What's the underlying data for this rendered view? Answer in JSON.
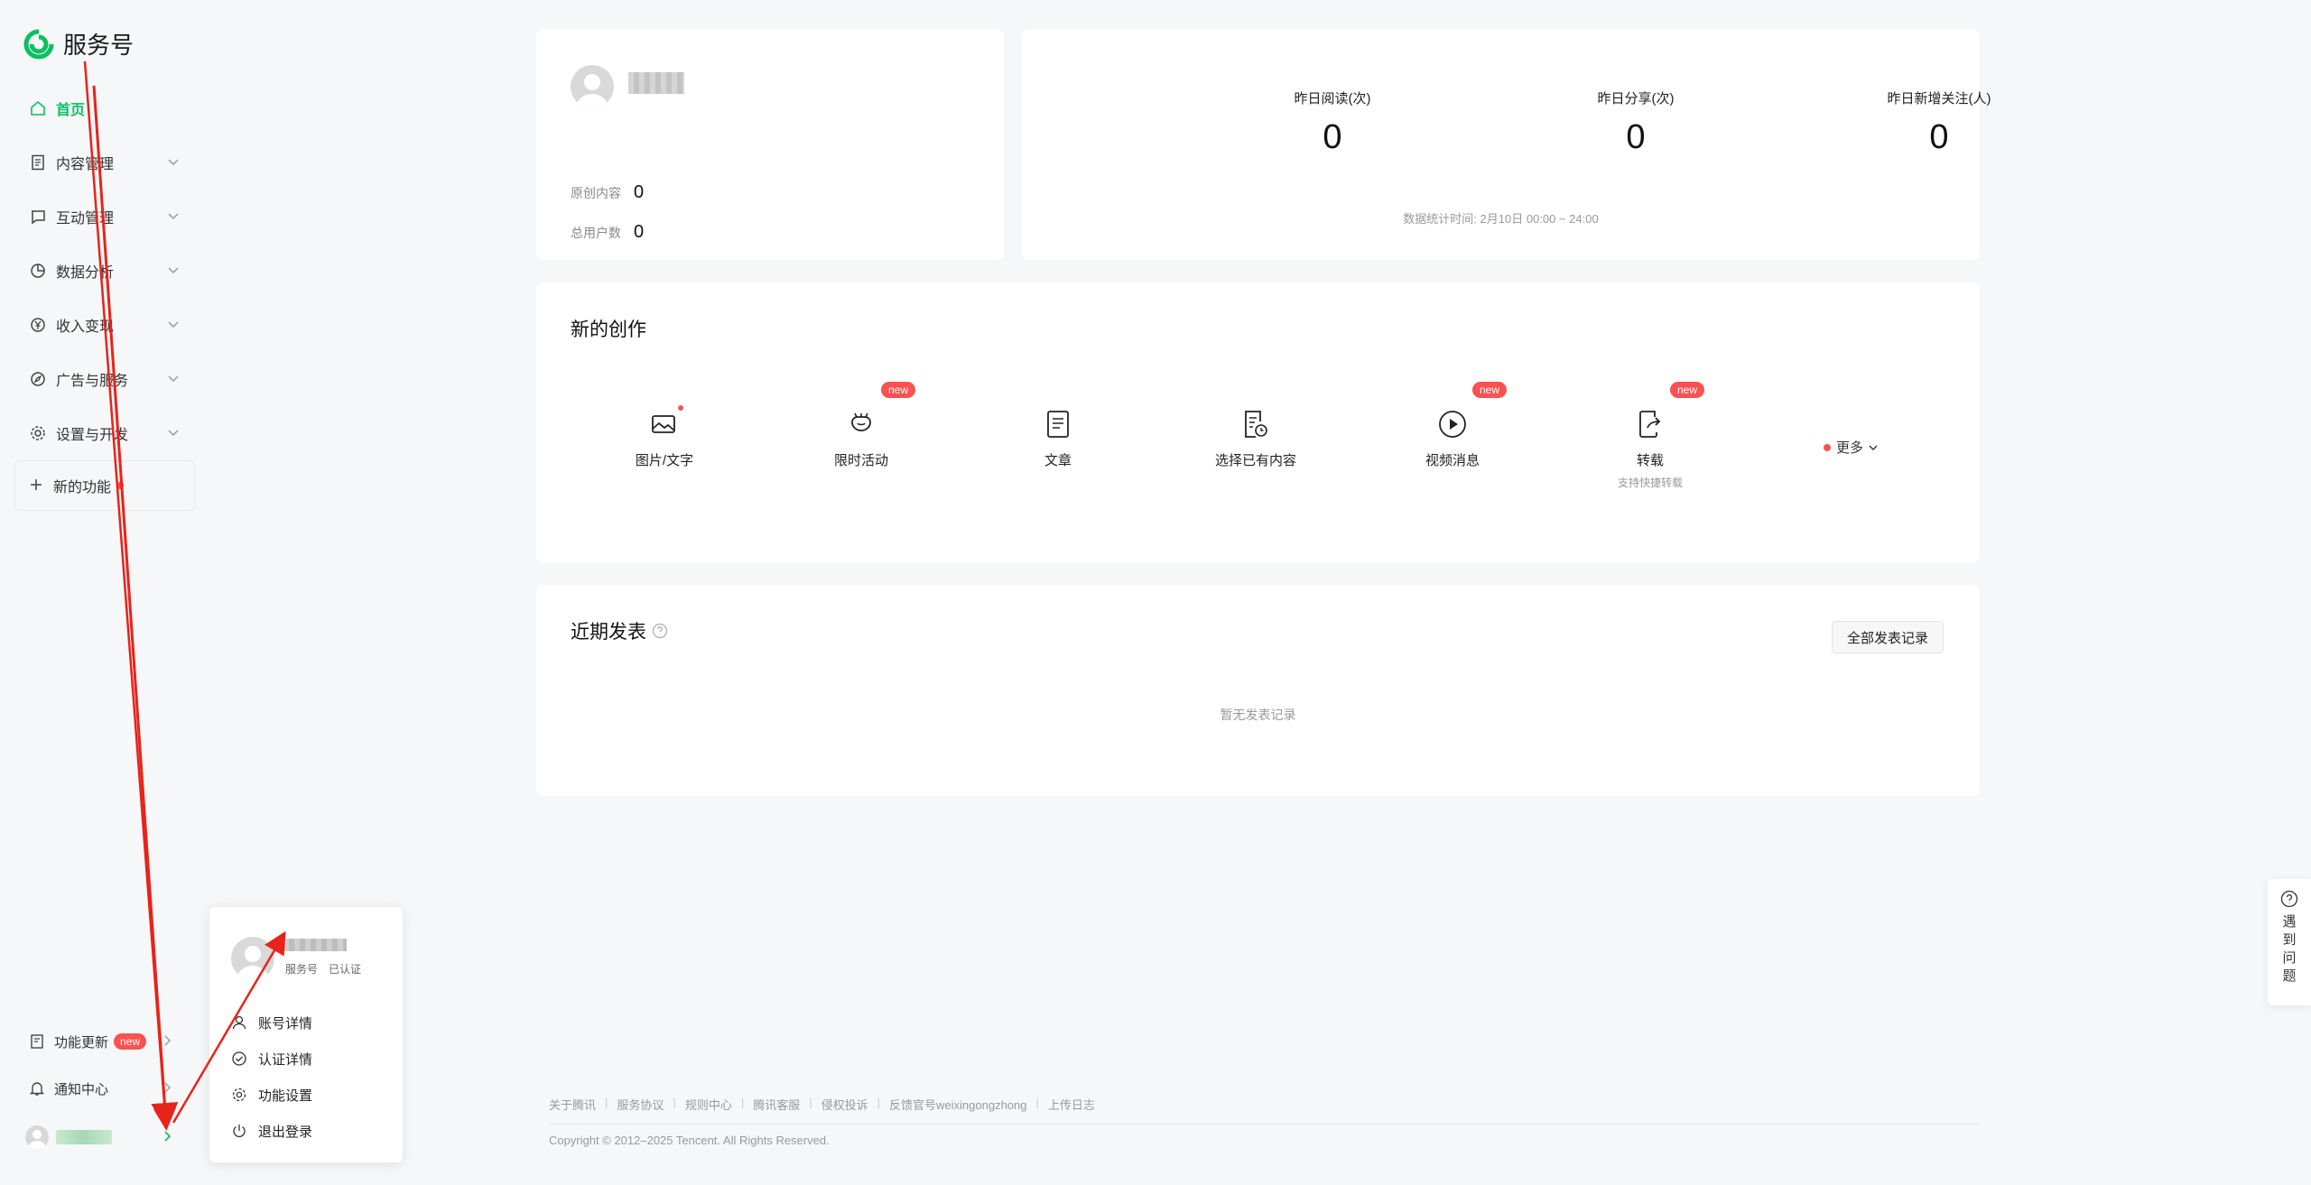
{
  "app": {
    "logo_text": "服务号",
    "brand_color": "#07c160"
  },
  "sidebar": {
    "items": [
      {
        "label": "首页",
        "icon": "home-icon",
        "active": true
      },
      {
        "label": "内容管理",
        "icon": "document-icon"
      },
      {
        "label": "互动管理",
        "icon": "message-icon"
      },
      {
        "label": "数据分析",
        "icon": "pie-chart-icon"
      },
      {
        "label": "收入变现",
        "icon": "yen-icon"
      },
      {
        "label": "广告与服务",
        "icon": "compass-icon"
      },
      {
        "label": "设置与开发",
        "icon": "gear-icon"
      }
    ],
    "new_features": "新的功能",
    "bottom": {
      "updates": "功能更新",
      "updates_badge": "new",
      "notifications": "通知中心"
    }
  },
  "popup": {
    "tag_type": "服务号",
    "tag_status": "已认证",
    "menu": [
      {
        "label": "账号详情",
        "icon": "user-icon"
      },
      {
        "label": "认证详情",
        "icon": "check-circle-icon"
      },
      {
        "label": "功能设置",
        "icon": "gear-icon"
      },
      {
        "label": "退出登录",
        "icon": "power-icon"
      }
    ]
  },
  "profile": {
    "original_label": "原创内容",
    "original_value": "0",
    "users_label": "总用户数",
    "users_value": "0"
  },
  "stats": {
    "read_label": "昨日阅读(次)",
    "read_value": "0",
    "share_label": "昨日分享(次)",
    "share_value": "0",
    "follow_label": "昨日新增关注(人)",
    "follow_value": "0",
    "footnote": "数据统计时间: 2月10日 00:00 ~ 24:00"
  },
  "create": {
    "title": "新的创作",
    "tools": [
      {
        "label": "图片/文字",
        "icon": "image-text-icon",
        "badge": "",
        "sub": ""
      },
      {
        "label": "限时活动",
        "icon": "gift-bag-icon",
        "badge": "new",
        "sub": ""
      },
      {
        "label": "文章",
        "icon": "article-icon",
        "badge": "",
        "sub": ""
      },
      {
        "label": "选择已有内容",
        "icon": "existing-content-icon",
        "badge": "",
        "sub": ""
      },
      {
        "label": "视频消息",
        "icon": "play-icon",
        "badge": "new",
        "sub": ""
      },
      {
        "label": "转载",
        "icon": "repost-icon",
        "badge": "new",
        "sub": "支持快捷转载"
      }
    ],
    "more": "更多"
  },
  "recent": {
    "title": "近期发表",
    "all_button": "全部发表记录",
    "empty": "暂无发表记录"
  },
  "footer": {
    "links": [
      "关于腾讯",
      "服务协议",
      "规则中心",
      "腾讯客服",
      "侵权投诉",
      "反馈官号weixingongzhong",
      "上传日志"
    ],
    "copyright": "Copyright © 2012–2025 Tencent. All Rights Reserved."
  },
  "help": {
    "label": "遇到问题"
  },
  "annotation_color": "#e8231a"
}
